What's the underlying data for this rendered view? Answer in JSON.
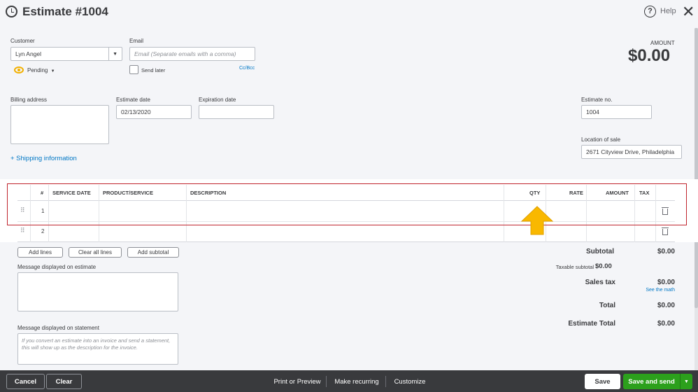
{
  "header": {
    "title": "Estimate #1004",
    "help_label": "Help"
  },
  "form": {
    "customer_label": "Customer",
    "customer_value": "Lyn Angel",
    "email_label": "Email",
    "email_placeholder": "Email (Separate emails with a comma)",
    "status_label": "Pending",
    "send_later_label": "Send later",
    "cc_bcc_label": "Cc/Bcc",
    "amount_label": "AMOUNT",
    "amount_value": "$0.00",
    "billing_address_label": "Billing address",
    "estimate_date_label": "Estimate date",
    "estimate_date_value": "02/13/2020",
    "expiration_date_label": "Expiration date",
    "estimate_no_label": "Estimate no.",
    "estimate_no_value": "1004",
    "location_label": "Location of sale",
    "location_value": "2671  Cityview Drive, Philadelphia",
    "shipping_link": "+ Shipping information"
  },
  "table": {
    "headers": {
      "num": "#",
      "service_date": "SERVICE DATE",
      "product": "PRODUCT/SERVICE",
      "description": "DESCRIPTION",
      "qty": "QTY",
      "rate": "RATE",
      "amount": "AMOUNT",
      "tax": "TAX"
    },
    "rows": [
      {
        "num": "1"
      },
      {
        "num": "2"
      }
    ]
  },
  "actions": {
    "add_lines": "Add lines",
    "clear_all_lines": "Clear all lines",
    "add_subtotal": "Add subtotal"
  },
  "messages": {
    "estimate_label": "Message displayed on estimate",
    "statement_label": "Message displayed on statement",
    "statement_placeholder": "If you convert an estimate into an invoice and send a statement, this will show up as the description for the invoice."
  },
  "totals": {
    "subtotal_label": "Subtotal",
    "subtotal_value": "$0.00",
    "taxable_label": "Taxable subtotal",
    "taxable_value": "$0.00",
    "sales_tax_label": "Sales tax",
    "sales_tax_value": "$0.00",
    "see_math_label": "See the math",
    "total_label": "Total",
    "total_value": "$0.00",
    "estimate_total_label": "Estimate Total",
    "estimate_total_value": "$0.00"
  },
  "footer": {
    "cancel": "Cancel",
    "clear": "Clear",
    "print_preview": "Print or Preview",
    "make_recurring": "Make recurring",
    "customize": "Customize",
    "save": "Save",
    "save_and_send": "Save and send"
  },
  "colors": {
    "highlight_border": "#c0232c",
    "arrow": "#f9b800",
    "primary_green": "#2ca01c",
    "link_blue": "#0077c5"
  }
}
